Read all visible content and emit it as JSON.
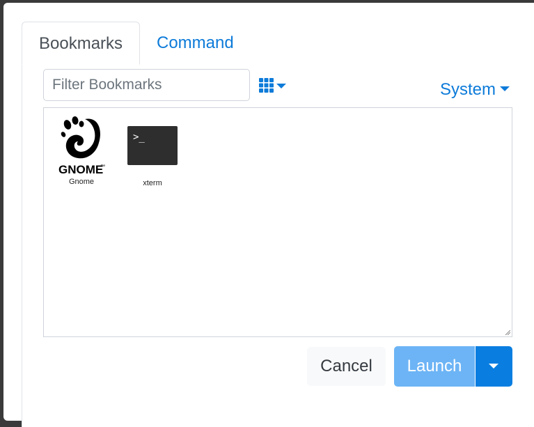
{
  "tabs": [
    {
      "label": "Bookmarks",
      "active": true
    },
    {
      "label": "Command",
      "active": false
    }
  ],
  "filter": {
    "placeholder": "Filter Bookmarks",
    "value": ""
  },
  "view_toggle": {
    "icon": "grid-icon"
  },
  "category_dropdown": {
    "label": "System"
  },
  "bookmarks": [
    {
      "label": "Gnome",
      "icon": "gnome-logo-icon",
      "logo_text": "GNOME",
      "logo_mark": "™"
    },
    {
      "label": "xterm",
      "icon": "terminal-icon",
      "prompt": ">_"
    }
  ],
  "actions": {
    "cancel_label": "Cancel",
    "launch_label": "Launch"
  },
  "colors": {
    "accent": "#0d7bd9",
    "launch": "#6cb4f5",
    "launch_split": "#0a7ee0",
    "backdrop": "#3a3a3a"
  }
}
